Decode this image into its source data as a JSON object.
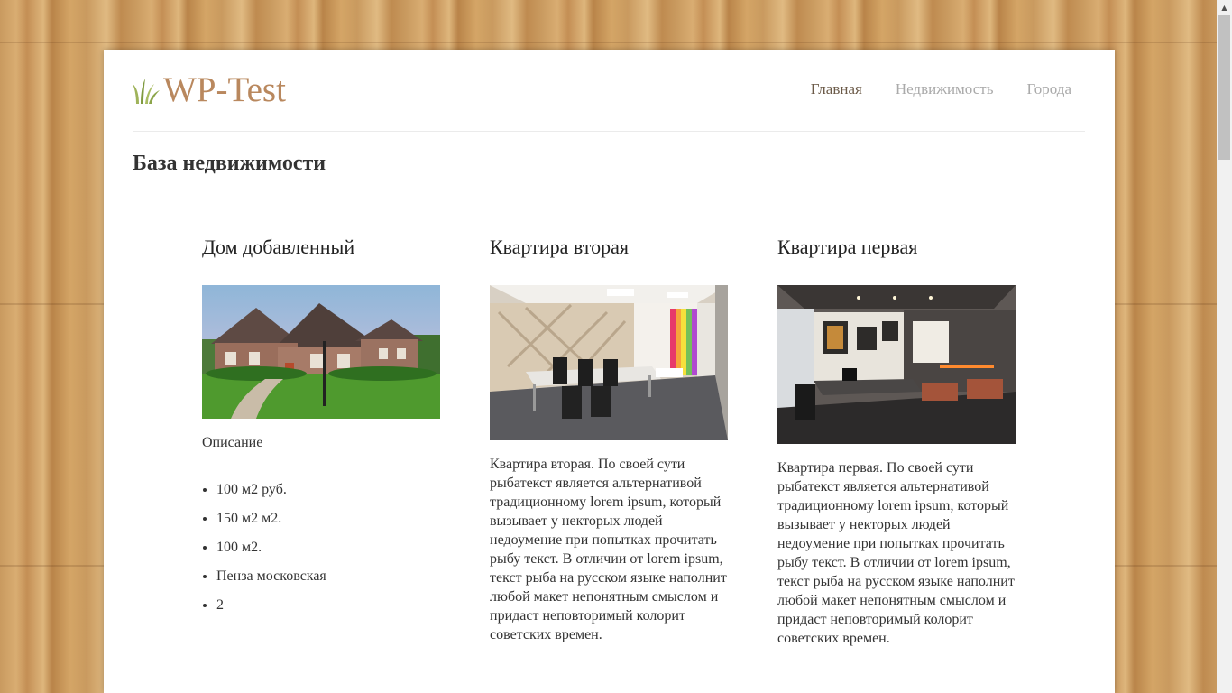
{
  "header": {
    "logo_text": "WP-Test",
    "nav": [
      {
        "label": "Главная",
        "active": true
      },
      {
        "label": "Недвижимость",
        "active": false
      },
      {
        "label": "Города",
        "active": false
      }
    ]
  },
  "page_title": "База недвижимости",
  "cards": [
    {
      "title": "Дом добавленный",
      "image_icon": "house-photo",
      "description": "Описание",
      "details": [
        "100 м2 руб.",
        "150 м2 м2.",
        "100 м2.",
        "Пенза московская",
        "2"
      ]
    },
    {
      "title": "Квартира вторая",
      "image_icon": "office-photo",
      "description": "Квартира вторая. По своей сути рыбатекст является альтернативой традиционному lorem ipsum, который вызывает у некторых людей недоумение при попытках прочитать рыбу текст. В отличии от lorem ipsum, текст рыба на русском языке наполнит любой макет непонятным смыслом и придаст неповторимый колорит советских времен.",
      "details": []
    },
    {
      "title": "Квартира первая",
      "image_icon": "office-photo",
      "description": "Квартира первая. По своей сути рыбатекст является альтернативой традиционному lorem ipsum, который вызывает у некторых людей недоумение при попытках прочитать рыбу текст. В отличии от lorem ipsum, текст рыба на русском языке наполнит любой макет непонятным смыслом и придаст неповторимый колорит советских времен.",
      "details": []
    }
  ],
  "colors": {
    "logo": "#b9885e",
    "nav_active": "#6b5a48",
    "nav_inactive": "#aaaaaa"
  }
}
